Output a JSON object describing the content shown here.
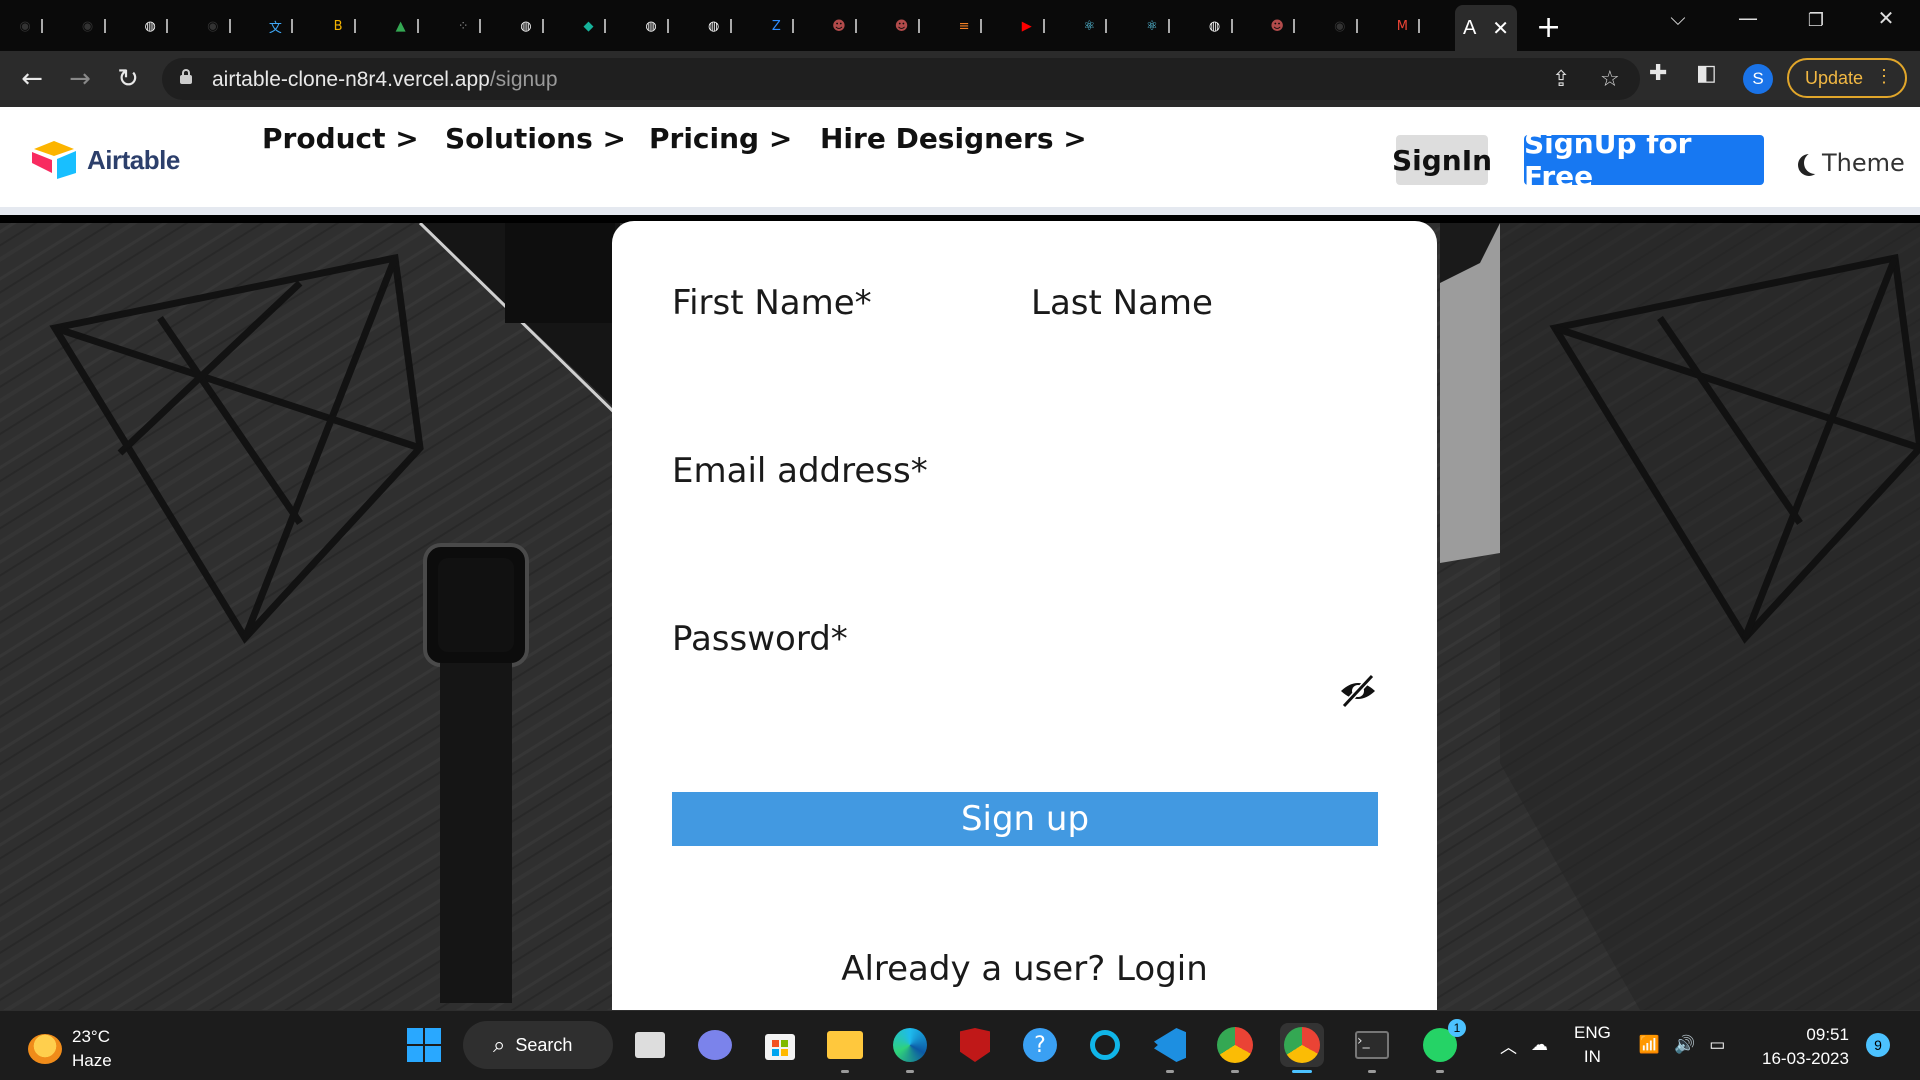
{
  "browser": {
    "tabs": [
      {
        "icon": "github-icon",
        "color": "#333333"
      },
      {
        "icon": "github-icon",
        "color": "#333333"
      },
      {
        "icon": "globe-icon",
        "color": "#ffffff"
      },
      {
        "icon": "github-icon",
        "color": "#333333"
      },
      {
        "icon": "translate-icon",
        "color": "#3fa7f5"
      },
      {
        "icon": "bold-b-icon",
        "color": "#f5b400"
      },
      {
        "icon": "drive-icon",
        "color": "#34a853"
      },
      {
        "icon": "dots-grid-icon",
        "color": "#888888"
      },
      {
        "icon": "globe-icon",
        "color": "#ffffff"
      },
      {
        "icon": "diamond-icon",
        "color": "#16b39b"
      },
      {
        "icon": "globe-icon",
        "color": "#ffffff"
      },
      {
        "icon": "globe-icon",
        "color": "#ffffff"
      },
      {
        "icon": "zoom-icon",
        "color": "#2d8cff"
      },
      {
        "icon": "avatar-icon",
        "color": "#b24b4b"
      },
      {
        "icon": "avatar-icon",
        "color": "#b24b4b"
      },
      {
        "icon": "stack-icon",
        "color": "#f48024"
      },
      {
        "icon": "youtube-icon",
        "color": "#ff0000"
      },
      {
        "icon": "react-icon",
        "color": "#61dafb"
      },
      {
        "icon": "react-icon",
        "color": "#61dafb"
      },
      {
        "icon": "globe-icon",
        "color": "#ffffff"
      },
      {
        "icon": "avatar-icon",
        "color": "#b24b4b"
      },
      {
        "icon": "github-icon",
        "color": "#333333"
      },
      {
        "icon": "gmail-icon",
        "color": "#ea4335"
      }
    ],
    "active_tab_letter": "A",
    "url_host": "airtable-clone-n8r4.vercel.app",
    "url_path": "/signup",
    "profile_initial": "S",
    "update_label": "Update"
  },
  "site": {
    "logo_text": "Airtable",
    "nav": [
      {
        "label": "Product >"
      },
      {
        "label": "Solutions >"
      },
      {
        "label": "Pricing >"
      },
      {
        "label": "Hire Designers >"
      }
    ],
    "signin_label": "SignIn",
    "signup_free_label": "SignUp for Free",
    "theme_label": "Theme"
  },
  "form": {
    "first_name_label": "First Name*",
    "last_name_label": "Last Name",
    "email_label": "Email address*",
    "password_label": "Password*",
    "submit_label": "Sign up",
    "login_prompt": "Already a user? Login",
    "submit_color": "#4299e1"
  },
  "taskbar": {
    "weather_temp": "23°C",
    "weather_desc": "Haze",
    "search_label": "Search",
    "lang_line1": "ENG",
    "lang_line2": "IN",
    "time": "09:51",
    "date": "16-03-2023",
    "notification_count": "9",
    "whatsapp_badge": "1"
  }
}
